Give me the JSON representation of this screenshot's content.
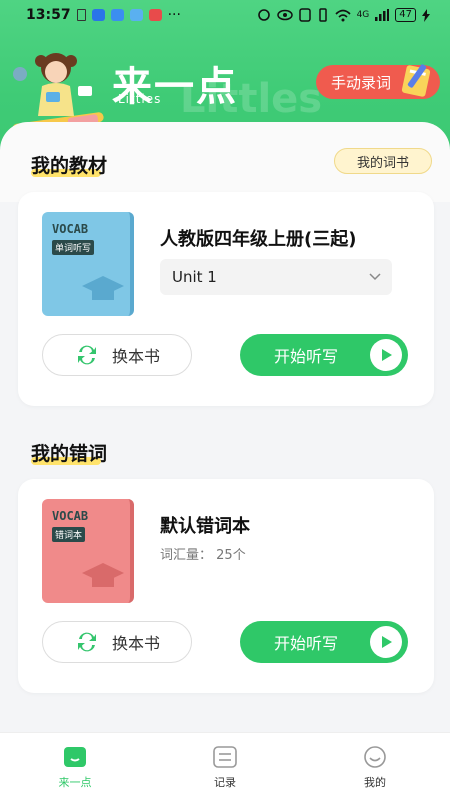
{
  "statusbar": {
    "time": "13:57",
    "extra": "···",
    "network": "4G",
    "battery": "47"
  },
  "header": {
    "logo": "来一点",
    "logo_sub": "Littles",
    "manual_button": "手动录词"
  },
  "textbook_section": {
    "title": "我的教材",
    "wordbook_button": "我的词书",
    "card": {
      "book_cover_title": "VOCAB",
      "book_cover_tag": "单词听写",
      "title": "人教版四年级上册(三起)",
      "unit_selected": "Unit 1",
      "swap_button": "换本书",
      "start_button": "开始听写"
    }
  },
  "mistakes_section": {
    "title": "我的错词",
    "card": {
      "book_cover_title": "VOCAB",
      "book_cover_tag": "错词本",
      "title": "默认错词本",
      "count_label": "词汇量：",
      "count_value": "25个",
      "swap_button": "换本书",
      "start_button": "开始听写"
    }
  },
  "bottom_nav": {
    "items": [
      {
        "label": "来一点",
        "icon": "book-icon",
        "active": true
      },
      {
        "label": "记录",
        "icon": "list-icon",
        "active": false
      },
      {
        "label": "我的",
        "icon": "smile-icon",
        "active": false
      }
    ]
  },
  "colors": {
    "brand_green": "#2fc868",
    "header_green": "#4fd483",
    "manual_red": "#f05b4e",
    "book_blue": "#7fc7e6",
    "book_pink": "#f08a8a"
  }
}
